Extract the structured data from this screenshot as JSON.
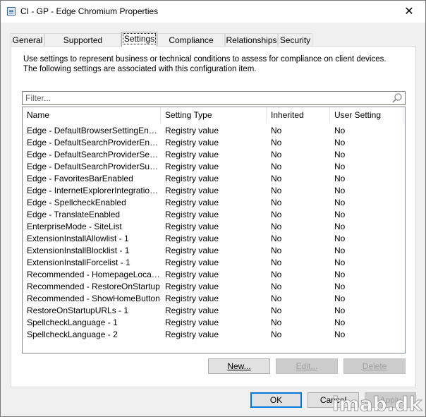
{
  "window": {
    "title": "CI - GP - Edge Chromium Properties",
    "close_glyph": "✕"
  },
  "tabs": [
    {
      "label": "General"
    },
    {
      "label": "Supported Platforms"
    },
    {
      "label": "Settings"
    },
    {
      "label": "Compliance Rules"
    },
    {
      "label": "Relationships"
    },
    {
      "label": "Security"
    }
  ],
  "active_tab": "Settings",
  "settings": {
    "description": "Use settings to represent business or technical conditions to assess for compliance on client devices. The following settings are associated with this configuration item.",
    "filter": {
      "placeholder": "Filter...",
      "value": ""
    },
    "columns": [
      "Name",
      "Setting Type",
      "Inherited",
      "User Setting"
    ],
    "rows": [
      [
        "Edge - DefaultBrowserSettingEnabled",
        "Registry value",
        "No",
        "No"
      ],
      [
        "Edge - DefaultSearchProviderEnabled",
        "Registry value",
        "No",
        "No"
      ],
      [
        "Edge - DefaultSearchProviderSearch...",
        "Registry value",
        "No",
        "No"
      ],
      [
        "Edge - DefaultSearchProviderSugges...",
        "Registry value",
        "No",
        "No"
      ],
      [
        "Edge - FavoritesBarEnabled",
        "Registry value",
        "No",
        "No"
      ],
      [
        "Edge - InternetExplorerIntegrationLevel",
        "Registry value",
        "No",
        "No"
      ],
      [
        "Edge - SpellcheckEnabled",
        "Registry value",
        "No",
        "No"
      ],
      [
        "Edge - TranslateEnabled",
        "Registry value",
        "No",
        "No"
      ],
      [
        "EnterpriseMode - SiteList",
        "Registry value",
        "No",
        "No"
      ],
      [
        "ExtensionInstallAllowlist - 1",
        "Registry value",
        "No",
        "No"
      ],
      [
        "ExtensionInstallBlocklist - 1",
        "Registry value",
        "No",
        "No"
      ],
      [
        "ExtensionInstallForcelist - 1",
        "Registry value",
        "No",
        "No"
      ],
      [
        "Recommended - HomepageLocation",
        "Registry value",
        "No",
        "No"
      ],
      [
        "Recommended - RestoreOnStartup",
        "Registry value",
        "No",
        "No"
      ],
      [
        "Recommended - ShowHomeButton",
        "Registry value",
        "No",
        "No"
      ],
      [
        "RestoreOnStartupURLs - 1",
        "Registry value",
        "No",
        "No"
      ],
      [
        "SpellcheckLanguage - 1",
        "Registry value",
        "No",
        "No"
      ],
      [
        "SpellcheckLanguage - 2",
        "Registry value",
        "No",
        "No"
      ]
    ],
    "buttons": {
      "new": "New...",
      "edit": "Edit...",
      "delete": "Delete"
    }
  },
  "dialog_buttons": {
    "ok": "OK",
    "cancel": "Cancel",
    "apply": "Apply"
  },
  "watermark": "imab.dk",
  "icons": {
    "app": "properties-window-icon",
    "search": "search-icon",
    "close": "close-icon"
  }
}
